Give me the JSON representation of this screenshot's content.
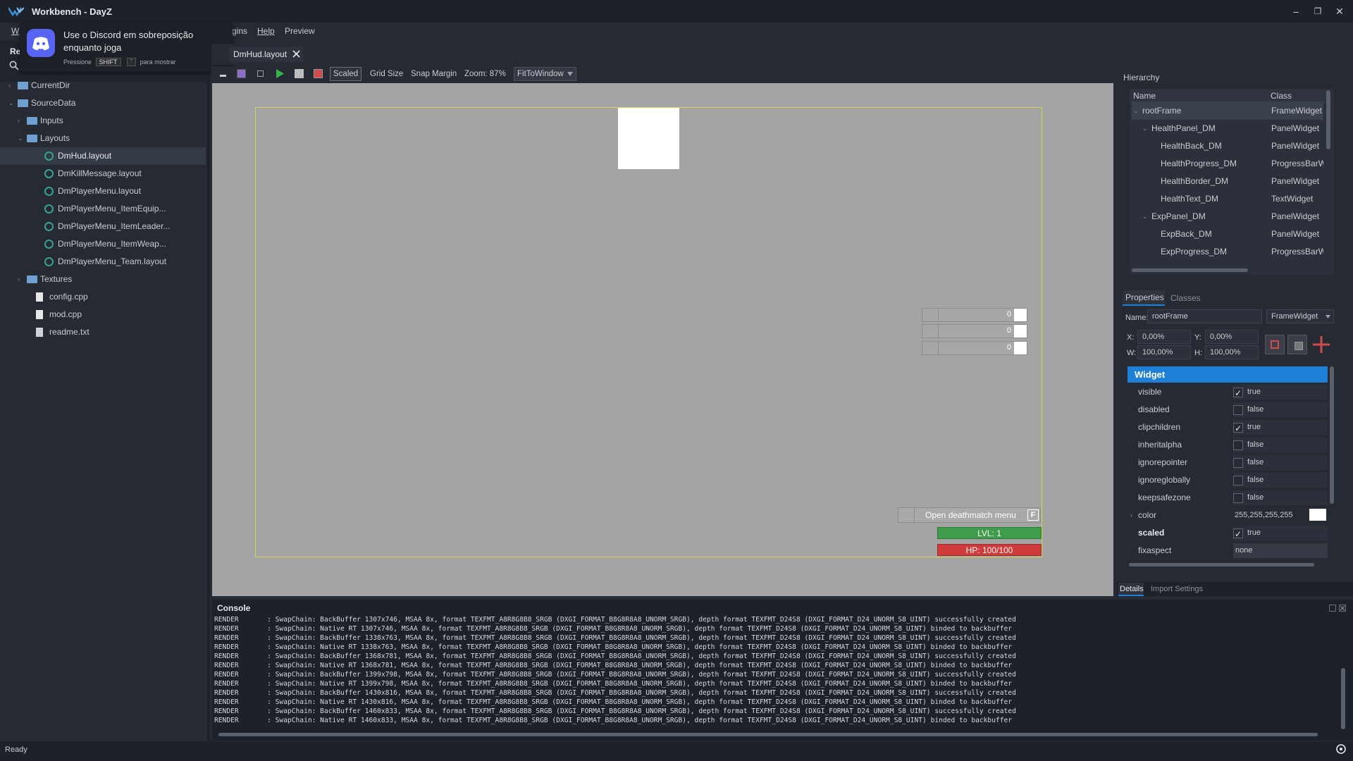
{
  "window": {
    "title": "Workbench - DayZ",
    "controls": [
      "–",
      "❐",
      "✕"
    ]
  },
  "menu": {
    "items": [
      "W",
      "gins",
      "Help",
      "Preview"
    ]
  },
  "discord_overlay": {
    "title": "Use o Discord em sobreposição enquanto joga",
    "hint_prefix": "Pressione",
    "key1": "SHIFT",
    "key2": "`",
    "hint_suffix": "para mostrar"
  },
  "left_panel": {
    "tab_label": "Re",
    "tree": [
      {
        "label": "CurrentDir",
        "type": "folder",
        "level": 0,
        "chevron": "›"
      },
      {
        "label": "SourceData",
        "type": "folder",
        "level": 0,
        "chevron": "⌄"
      },
      {
        "label": "Inputs",
        "type": "folder",
        "level": 1,
        "chevron": "›"
      },
      {
        "label": "Layouts",
        "type": "folder",
        "level": 1,
        "chevron": "⌄"
      },
      {
        "label": "DmHud.layout",
        "type": "layout",
        "level": 2,
        "selected": true
      },
      {
        "label": "DmKillMessage.layout",
        "type": "layout",
        "level": 2
      },
      {
        "label": "DmPlayerMenu.layout",
        "type": "layout",
        "level": 2
      },
      {
        "label": "DmPlayerMenu_ItemEquip...",
        "type": "layout",
        "level": 2
      },
      {
        "label": "DmPlayerMenu_ItemLeader...",
        "type": "layout",
        "level": 2
      },
      {
        "label": "DmPlayerMenu_ItemWeap...",
        "type": "layout",
        "level": 2
      },
      {
        "label": "DmPlayerMenu_Team.layout",
        "type": "layout",
        "level": 2
      },
      {
        "label": "Textures",
        "type": "folder",
        "level": 1,
        "chevron": "›"
      },
      {
        "label": "config.cpp",
        "type": "file",
        "level": 1
      },
      {
        "label": "mod.cpp",
        "type": "file",
        "level": 1
      },
      {
        "label": "readme.txt",
        "type": "text",
        "level": 1
      }
    ]
  },
  "editor": {
    "tab_label": "DmHud.layout",
    "toolbar": {
      "scaled": "Scaled",
      "grid_size": "Grid Size",
      "snap_margin": "Snap Margin",
      "zoom": "Zoom: 87%",
      "fit": "FitToWindow"
    },
    "canvas": {
      "inputs": [
        "0",
        "0",
        "0"
      ],
      "menu_button": "Open deathmatch menu",
      "menu_key": "F",
      "level": "LVL: 1",
      "health": "HP: 100/100"
    }
  },
  "hierarchy": {
    "title": "Hierarchy",
    "col_name": "Name",
    "col_class": "Class",
    "rows": [
      {
        "name": "rootFrame",
        "class": "FrameWidget",
        "level": 0,
        "chevron": "⌄",
        "selected": true
      },
      {
        "name": "HealthPanel_DM",
        "class": "PanelWidget",
        "level": 1,
        "chevron": "⌄"
      },
      {
        "name": "HealthBack_DM",
        "class": "PanelWidget",
        "level": 2
      },
      {
        "name": "HealthProgress_DM",
        "class": "ProgressBarW",
        "level": 2
      },
      {
        "name": "HealthBorder_DM",
        "class": "PanelWidget",
        "level": 2
      },
      {
        "name": "HealthText_DM",
        "class": "TextWidget",
        "level": 2
      },
      {
        "name": "ExpPanel_DM",
        "class": "PanelWidget",
        "level": 1,
        "chevron": "⌄"
      },
      {
        "name": "ExpBack_DM",
        "class": "PanelWidget",
        "level": 2
      },
      {
        "name": "ExpProgress_DM",
        "class": "ProgressBarW",
        "level": 2
      }
    ]
  },
  "properties": {
    "tab_properties": "Properties",
    "tab_classes": "Classes",
    "name_label": "Name:",
    "name_value": "rootFrame",
    "class_value": "FrameWidget",
    "x_label": "X:",
    "x_value": "0,00%",
    "y_label": "Y:",
    "y_value": "0,00%",
    "w_label": "W:",
    "w_value": "100,00%",
    "h_label": "H:",
    "h_value": "100,00%",
    "section": "Widget",
    "rows": [
      {
        "name": "visible",
        "value": "true",
        "checked": true
      },
      {
        "name": "disabled",
        "value": "false",
        "checked": false
      },
      {
        "name": "clipchildren",
        "value": "true",
        "checked": true
      },
      {
        "name": "inheritalpha",
        "value": "false",
        "checked": false
      },
      {
        "name": "ignorepointer",
        "value": "false",
        "checked": false
      },
      {
        "name": "ignoreglobally",
        "value": "false",
        "checked": false
      },
      {
        "name": "keepsafezone",
        "value": "false",
        "checked": false
      },
      {
        "name": "color",
        "value": "255,255,255,255",
        "kind": "color",
        "chevron": "›"
      },
      {
        "name": "scaled",
        "value": "true",
        "checked": true,
        "bold": true
      },
      {
        "name": "fixaspect",
        "value": "none",
        "kind": "select"
      }
    ],
    "bottom_tabs": [
      "Details",
      "Import Settings"
    ]
  },
  "console": {
    "title": "Console",
    "lines": [
      "RENDER       : SwapChain: BackBuffer 1307x746, MSAA 8x, format TEXFMT_A8R8G8B8_SRGB (DXGI_FORMAT_B8G8R8A8_UNORM_SRGB), depth format TEXFMT_D24S8 (DXGI_FORMAT_D24_UNORM_S8_UINT) successfully created",
      "RENDER       : SwapChain: Native RT 1307x746, MSAA 8x, format TEXFMT_A8R8G8B8_SRGB (DXGI_FORMAT_B8G8R8A8_UNORM_SRGB), depth format TEXFMT_D24S8 (DXGI_FORMAT_D24_UNORM_S8_UINT) binded to backbuffer",
      "RENDER       : SwapChain: BackBuffer 1338x763, MSAA 8x, format TEXFMT_A8R8G8B8_SRGB (DXGI_FORMAT_B8G8R8A8_UNORM_SRGB), depth format TEXFMT_D24S8 (DXGI_FORMAT_D24_UNORM_S8_UINT) successfully created",
      "RENDER       : SwapChain: Native RT 1338x763, MSAA 8x, format TEXFMT_A8R8G8B8_SRGB (DXGI_FORMAT_B8G8R8A8_UNORM_SRGB), depth format TEXFMT_D24S8 (DXGI_FORMAT_D24_UNORM_S8_UINT) binded to backbuffer",
      "RENDER       : SwapChain: BackBuffer 1368x781, MSAA 8x, format TEXFMT_A8R8G8B8_SRGB (DXGI_FORMAT_B8G8R8A8_UNORM_SRGB), depth format TEXFMT_D24S8 (DXGI_FORMAT_D24_UNORM_S8_UINT) successfully created",
      "RENDER       : SwapChain: Native RT 1368x781, MSAA 8x, format TEXFMT_A8R8G8B8_SRGB (DXGI_FORMAT_B8G8R8A8_UNORM_SRGB), depth format TEXFMT_D24S8 (DXGI_FORMAT_D24_UNORM_S8_UINT) binded to backbuffer",
      "RENDER       : SwapChain: BackBuffer 1399x798, MSAA 8x, format TEXFMT_A8R8G8B8_SRGB (DXGI_FORMAT_B8G8R8A8_UNORM_SRGB), depth format TEXFMT_D24S8 (DXGI_FORMAT_D24_UNORM_S8_UINT) successfully created",
      "RENDER       : SwapChain: Native RT 1399x798, MSAA 8x, format TEXFMT_A8R8G8B8_SRGB (DXGI_FORMAT_B8G8R8A8_UNORM_SRGB), depth format TEXFMT_D24S8 (DXGI_FORMAT_D24_UNORM_S8_UINT) binded to backbuffer",
      "RENDER       : SwapChain: BackBuffer 1430x816, MSAA 8x, format TEXFMT_A8R8G8B8_SRGB (DXGI_FORMAT_B8G8R8A8_UNORM_SRGB), depth format TEXFMT_D24S8 (DXGI_FORMAT_D24_UNORM_S8_UINT) successfully created",
      "RENDER       : SwapChain: Native RT 1430x816, MSAA 8x, format TEXFMT_A8R8G8B8_SRGB (DXGI_FORMAT_B8G8R8A8_UNORM_SRGB), depth format TEXFMT_D24S8 (DXGI_FORMAT_D24_UNORM_S8_UINT) binded to backbuffer",
      "RENDER       : SwapChain: BackBuffer 1460x833, MSAA 8x, format TEXFMT_A8R8G8B8_SRGB (DXGI_FORMAT_B8G8R8A8_UNORM_SRGB), depth format TEXFMT_D24S8 (DXGI_FORMAT_D24_UNORM_S8_UINT) successfully created",
      "RENDER       : SwapChain: Native RT 1460x833, MSAA 8x, format TEXFMT_A8R8G8B8_SRGB (DXGI_FORMAT_B8G8R8A8_UNORM_SRGB), depth format TEXFMT_D24S8 (DXGI_FORMAT_D24_UNORM_S8_UINT) binded to backbuffer"
    ]
  },
  "status": {
    "text": "Ready"
  },
  "colors": {
    "accent": "#1e7fd6",
    "level_bar": "#3f9c4a",
    "health_bar": "#cf3b3b",
    "canvas_border": "#d4d45a",
    "discord": "#5865f2"
  }
}
